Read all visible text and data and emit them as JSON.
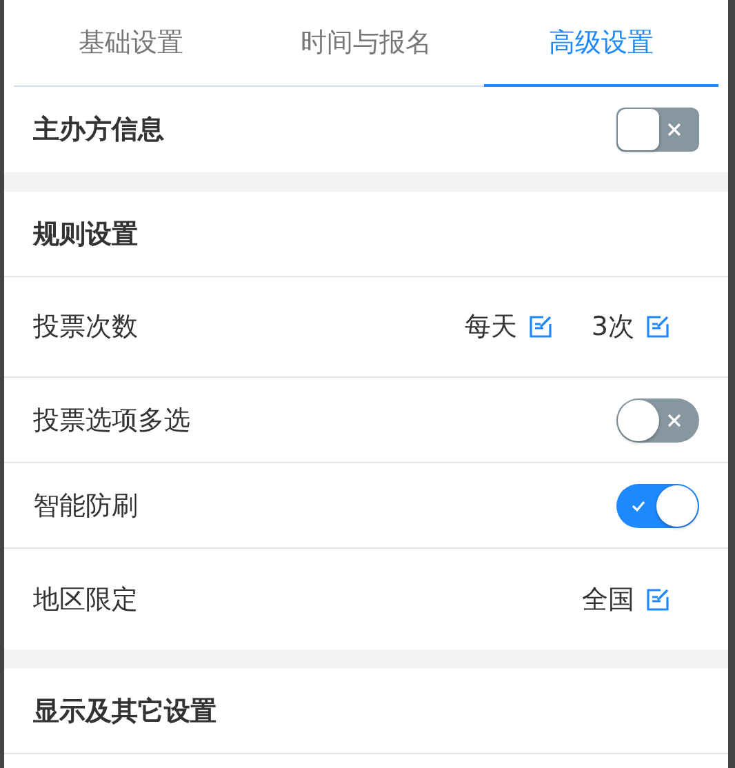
{
  "tabs": [
    {
      "label": "基础设置",
      "selected": false
    },
    {
      "label": "时间与报名",
      "selected": false
    },
    {
      "label": "高级设置",
      "selected": true
    }
  ],
  "groups": [
    {
      "rows": [
        {
          "kind": "title",
          "label": "主办方信息",
          "switch": {
            "on": false
          }
        }
      ]
    },
    {
      "rows": [
        {
          "kind": "title",
          "label": "规则设置"
        },
        {
          "kind": "edit",
          "label": "投票次数",
          "values": [
            "每天",
            "3次"
          ]
        },
        {
          "kind": "switch",
          "label": "投票选项多选",
          "on": false
        },
        {
          "kind": "switch",
          "label": "智能防刷",
          "on": true
        },
        {
          "kind": "edit",
          "label": "地区限定",
          "values": [
            "全国"
          ]
        }
      ]
    },
    {
      "rows": [
        {
          "kind": "title",
          "label": "显示及其它设置"
        }
      ]
    }
  ]
}
